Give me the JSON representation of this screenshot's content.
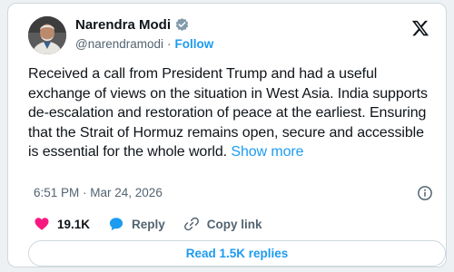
{
  "author": {
    "display_name": "Narendra Modi",
    "handle": "@narendramodi",
    "separator": "·",
    "follow_label": "Follow",
    "verified_color": "#829aab"
  },
  "tweet": {
    "text": "Received a call from President Trump and had a useful exchange of views on the situation in West Asia. India supports de-escalation and restoration of peace at the earliest. Ensuring that the Strait of Hormuz remains open, secure and accessible is essential for the whole world.",
    "show_more_label": "Show more",
    "timestamp": "6:51 PM · Mar 24, 2026"
  },
  "actions": {
    "likes": "19.1K",
    "reply_label": "Reply",
    "copy_link_label": "Copy link"
  },
  "replies_button_label": "Read 1.5K replies",
  "colors": {
    "accent": "#1d9bf0",
    "like": "#f91880",
    "text": "#0f1419",
    "muted": "#536471"
  }
}
